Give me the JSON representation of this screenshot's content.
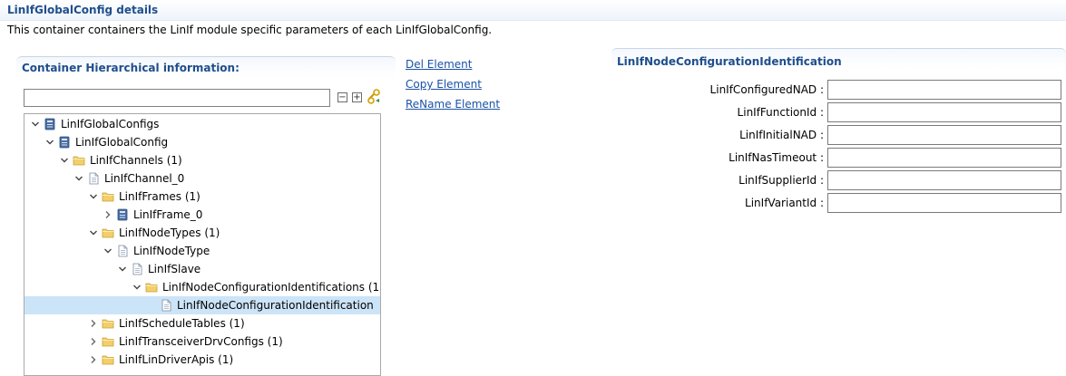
{
  "header": {
    "title": "LinIfGlobalConfig details",
    "description": "This container containers the LinIf module specific parameters of each LinIfGlobalConfig."
  },
  "hierarchy": {
    "title": "Container Hierarchical information:",
    "filter_value": "",
    "collapse_all_symbol": "−",
    "expand_all_symbol": "+",
    "tree": [
      {
        "label": "LinIfGlobalConfigs",
        "depth": 0,
        "expander": "expanded",
        "icon": "module-icon",
        "selected": false
      },
      {
        "label": "LinIfGlobalConfig",
        "depth": 1,
        "expander": "expanded",
        "icon": "module-icon",
        "selected": false
      },
      {
        "label": "LinIfChannels (1)",
        "depth": 2,
        "expander": "expanded",
        "icon": "folder-icon",
        "selected": false
      },
      {
        "label": "LinIfChannel_0",
        "depth": 3,
        "expander": "expanded",
        "icon": "document-icon",
        "selected": false
      },
      {
        "label": "LinIfFrames (1)",
        "depth": 4,
        "expander": "expanded",
        "icon": "folder-icon",
        "selected": false
      },
      {
        "label": "LinIfFrame_0",
        "depth": 5,
        "expander": "collapsed",
        "icon": "module-icon",
        "selected": false
      },
      {
        "label": "LinIfNodeTypes (1)",
        "depth": 4,
        "expander": "expanded",
        "icon": "folder-icon",
        "selected": false
      },
      {
        "label": "LinIfNodeType",
        "depth": 5,
        "expander": "expanded",
        "icon": "document-icon",
        "selected": false
      },
      {
        "label": "LinIfSlave",
        "depth": 6,
        "expander": "expanded",
        "icon": "document-icon",
        "selected": false
      },
      {
        "label": "LinIfNodeConfigurationIdentifications (1)",
        "depth": 7,
        "expander": "expanded",
        "icon": "folder-icon",
        "selected": false
      },
      {
        "label": "LinIfNodeConfigurationIdentification",
        "depth": 8,
        "expander": "none",
        "icon": "document-icon",
        "selected": true
      },
      {
        "label": "LinIfScheduleTables (1)",
        "depth": 4,
        "expander": "collapsed",
        "icon": "folder-icon",
        "selected": false
      },
      {
        "label": "LinIfTransceiverDrvConfigs (1)",
        "depth": 4,
        "expander": "collapsed",
        "icon": "folder-icon",
        "selected": false
      },
      {
        "label": "LinIfLinDriverApis (1)",
        "depth": 4,
        "expander": "collapsed",
        "icon": "folder-icon",
        "selected": false
      }
    ]
  },
  "actions": {
    "del": "Del Element",
    "copy": "Copy Element",
    "rename": "ReName Element"
  },
  "params": {
    "title": "LinIfNodeConfigurationIdentification",
    "fields": [
      {
        "label": "LinIfConfiguredNAD :",
        "value": ""
      },
      {
        "label": "LinIfFunctionId :",
        "value": ""
      },
      {
        "label": "LinIfInitialNAD :",
        "value": ""
      },
      {
        "label": "LinIfNasTimeout :",
        "value": ""
      },
      {
        "label": "LinIfSupplierId :",
        "value": ""
      },
      {
        "label": "LinIfVariantId :",
        "value": ""
      }
    ]
  },
  "colors": {
    "title_blue": "#1f4e8c",
    "link_blue": "#1a52a6",
    "selection": "#cce4f7",
    "folder": "#f3cf6b",
    "module_icon": "#4a6fa5"
  }
}
